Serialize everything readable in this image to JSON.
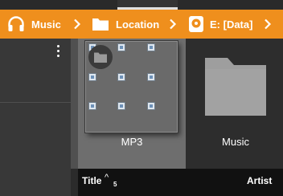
{
  "breadcrumb": {
    "items": [
      {
        "label": "Music",
        "icon": "headphones-icon"
      },
      {
        "label": "Location",
        "icon": "folder-icon"
      },
      {
        "label": "E: [Data]",
        "icon": "disc-icon"
      }
    ],
    "separator_icon": "chevron-right-icon",
    "accent_color": "#ef8f1d"
  },
  "drawer": {
    "menu_icon": "more-vert-icon"
  },
  "tiles": [
    {
      "label": "MP3",
      "state": "selected-dragging"
    },
    {
      "label": "Music",
      "icon": "folder-icon"
    }
  ],
  "list_header": {
    "title_label": "Title",
    "sort_indicator": "^",
    "count": "5",
    "artist_label": "Artist"
  }
}
